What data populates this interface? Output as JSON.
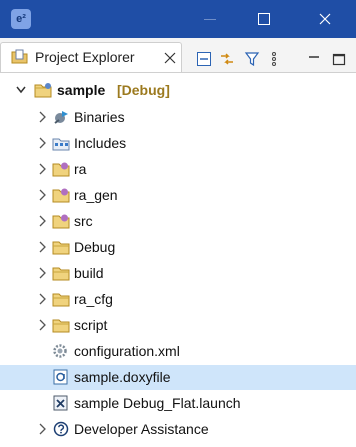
{
  "window": {
    "app_icon_text": "e²"
  },
  "view": {
    "tab_label": "Project Explorer"
  },
  "tree": {
    "project": {
      "name": "sample",
      "decoration": "[Debug]"
    },
    "items": [
      {
        "label": "Binaries"
      },
      {
        "label": "Includes"
      },
      {
        "label": "ra"
      },
      {
        "label": "ra_gen"
      },
      {
        "label": "src"
      },
      {
        "label": "Debug"
      },
      {
        "label": "build"
      },
      {
        "label": "ra_cfg"
      },
      {
        "label": "script"
      },
      {
        "label": "configuration.xml"
      },
      {
        "label": "sample.doxyfile"
      },
      {
        "label": "sample Debug_Flat.launch"
      },
      {
        "label": "Developer Assistance"
      }
    ]
  }
}
